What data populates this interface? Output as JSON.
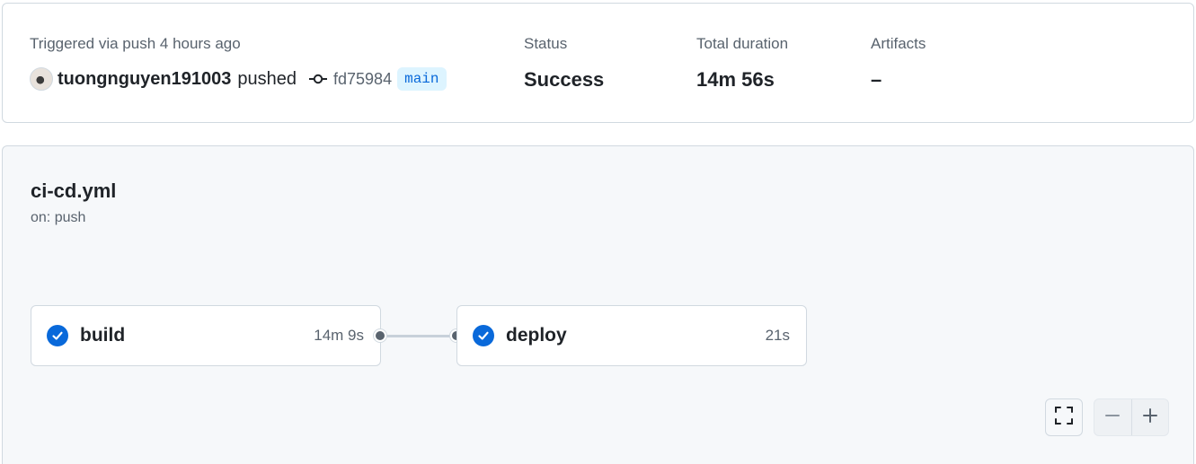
{
  "summary": {
    "triggered_text": "Triggered via push 4 hours ago",
    "username": "tuongnguyen191003",
    "action": "pushed",
    "commit_sha": "fd75984",
    "branch": "main",
    "status_label": "Status",
    "status_value": "Success",
    "duration_label": "Total duration",
    "duration_value": "14m 56s",
    "artifacts_label": "Artifacts",
    "artifacts_value": "–"
  },
  "workflow": {
    "name": "ci-cd.yml",
    "trigger": "on: push",
    "jobs": [
      {
        "name": "build",
        "duration": "14m 9s",
        "status": "success"
      },
      {
        "name": "deploy",
        "duration": "21s",
        "status": "success"
      }
    ]
  },
  "controls": {
    "fullscreen_icon": "fullscreen-icon",
    "zoom_out_icon": "minus-icon",
    "zoom_in_icon": "plus-icon"
  },
  "colors": {
    "success_blue": "#0969da",
    "branch_bg": "#ddf4ff"
  }
}
